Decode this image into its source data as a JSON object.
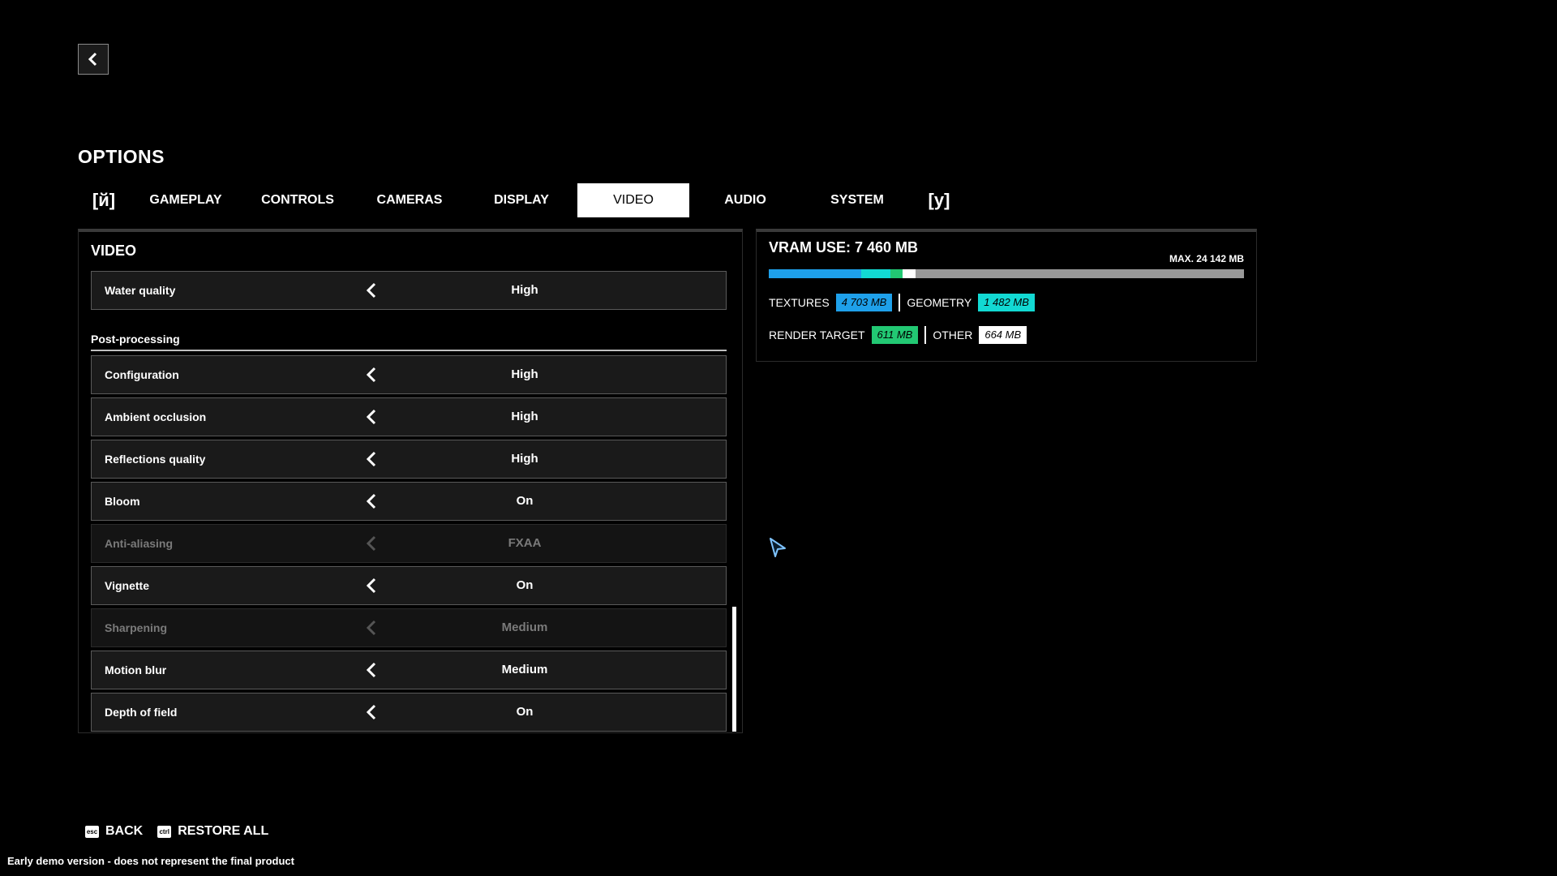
{
  "page": {
    "title": "OPTIONS"
  },
  "tabs": {
    "prev_key": "[й]",
    "next_key": "[y]",
    "items": [
      {
        "label": "GAMEPLAY"
      },
      {
        "label": "CONTROLS"
      },
      {
        "label": "CAMERAS"
      },
      {
        "label": "DISPLAY"
      },
      {
        "label": "VIDEO",
        "active": true
      },
      {
        "label": "AUDIO"
      },
      {
        "label": "SYSTEM"
      }
    ]
  },
  "video_panel": {
    "title": "VIDEO",
    "water_quality": {
      "label": "Water quality",
      "value": "High"
    },
    "section": "Post-processing",
    "rows": [
      {
        "label": "Configuration",
        "value": "High",
        "enabled": true
      },
      {
        "label": "Ambient occlusion",
        "value": "High",
        "enabled": true
      },
      {
        "label": "Reflections quality",
        "value": "High",
        "enabled": true
      },
      {
        "label": "Bloom",
        "value": "On",
        "enabled": true
      },
      {
        "label": "Anti-aliasing",
        "value": "FXAA",
        "enabled": false
      },
      {
        "label": "Vignette",
        "value": "On",
        "enabled": true
      },
      {
        "label": "Sharpening",
        "value": "Medium",
        "enabled": false
      },
      {
        "label": "Motion blur",
        "value": "Medium",
        "enabled": true
      },
      {
        "label": "Depth of field",
        "value": "On",
        "enabled": true
      }
    ]
  },
  "vram": {
    "title": "VRAM USE: 7 460 MB",
    "max_label": "MAX. 24 142 MB",
    "max_mb": 24142,
    "segments": [
      {
        "name": "TEXTURES",
        "value_label": "4 703 MB",
        "mb": 4703,
        "color": "#1ea0ea"
      },
      {
        "name": "GEOMETRY",
        "value_label": "1 482 MB",
        "mb": 1482,
        "color": "#12d9d3"
      },
      {
        "name": "RENDER TARGET",
        "value_label": "611 MB",
        "mb": 611,
        "color": "#22c873"
      },
      {
        "name": "OTHER",
        "value_label": "664 MB",
        "mb": 664,
        "color": "#ffffff"
      }
    ]
  },
  "footer": {
    "back_key": "esc",
    "back_label": "BACK",
    "restore_key": "ctrl",
    "restore_label": "RESTORE ALL",
    "disclaimer": "Early demo version - does not represent the final product"
  },
  "icons": {
    "back": "chevron-left-icon",
    "row_arrow": "chevron-left-icon",
    "cursor": "mouse-cursor-icon"
  }
}
